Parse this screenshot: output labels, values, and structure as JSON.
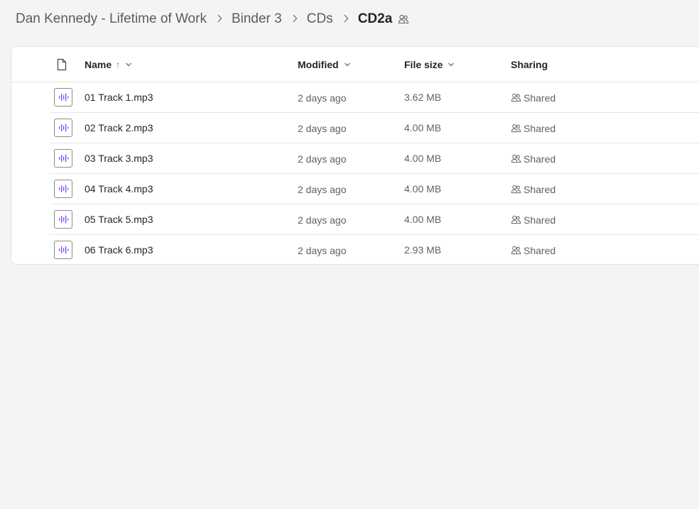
{
  "breadcrumb": {
    "items": [
      {
        "label": "Dan Kennedy - Lifetime of Work"
      },
      {
        "label": "Binder 3"
      },
      {
        "label": "CDs"
      },
      {
        "label": "CD2a"
      }
    ],
    "current_icon": "people-shared-icon"
  },
  "table": {
    "columns": {
      "type_icon": "document-icon",
      "name": "Name",
      "name_sort_indicator": "↑",
      "modified": "Modified",
      "file_size": "File size",
      "sharing": "Sharing"
    },
    "rows": [
      {
        "icon": "audio-file-icon",
        "name": "01 Track 1.mp3",
        "modified": "2 days ago",
        "size": "3.62 MB",
        "sharing": "Shared"
      },
      {
        "icon": "audio-file-icon",
        "name": "02 Track 2.mp3",
        "modified": "2 days ago",
        "size": "4.00 MB",
        "sharing": "Shared"
      },
      {
        "icon": "audio-file-icon",
        "name": "03 Track 3.mp3",
        "modified": "2 days ago",
        "size": "4.00 MB",
        "sharing": "Shared"
      },
      {
        "icon": "audio-file-icon",
        "name": "04 Track 4.mp3",
        "modified": "2 days ago",
        "size": "4.00 MB",
        "sharing": "Shared"
      },
      {
        "icon": "audio-file-icon",
        "name": "05 Track 5.mp3",
        "modified": "2 days ago",
        "size": "4.00 MB",
        "sharing": "Shared"
      },
      {
        "icon": "audio-file-icon",
        "name": "06 Track 6.mp3",
        "modified": "2 days ago",
        "size": "2.93 MB",
        "sharing": "Shared"
      }
    ]
  },
  "colors": {
    "background": "#f4f4f4",
    "panel": "#ffffff",
    "audio_icon_accent": "#8a3ffc",
    "text_primary": "#242424",
    "text_secondary": "#616161"
  }
}
